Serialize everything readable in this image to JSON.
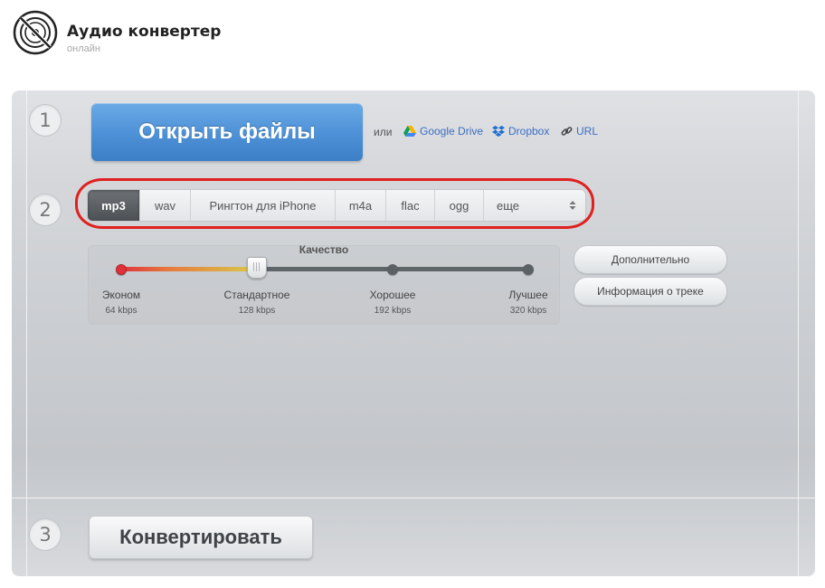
{
  "header": {
    "title": "Аудио конвертер",
    "subtitle": "онлайн",
    "logo_icon": "vinyl-disc-slash-icon"
  },
  "steps": [
    "1",
    "2",
    "3"
  ],
  "open": {
    "button_label": "Открыть файлы",
    "or_text": "или",
    "sources": [
      {
        "label": "Google Drive",
        "icon": "google-drive-icon"
      },
      {
        "label": "Dropbox",
        "icon": "dropbox-icon"
      },
      {
        "label": "URL",
        "icon": "link-icon"
      }
    ]
  },
  "formats": {
    "tabs": [
      "mp3",
      "wav",
      "Рингтон для iPhone",
      "m4a",
      "flac",
      "ogg"
    ],
    "more_label": "еще",
    "selected": "mp3"
  },
  "quality": {
    "title": "Качество",
    "levels": [
      {
        "name": "Эконом",
        "rate": "64 kbps"
      },
      {
        "name": "Стандартное",
        "rate": "128 kbps"
      },
      {
        "name": "Хорошее",
        "rate": "192 kbps"
      },
      {
        "name": "Лучшее",
        "rate": "320 kbps"
      }
    ],
    "selected_index": 1
  },
  "side_buttons": {
    "advanced": "Дополнительно",
    "track_info": "Информация о треке"
  },
  "convert": {
    "button_label": "Конвертировать"
  },
  "colors": {
    "accent_blue": "#4d90d6",
    "highlight_red": "#e02020",
    "link_blue": "#3b6fc4"
  }
}
